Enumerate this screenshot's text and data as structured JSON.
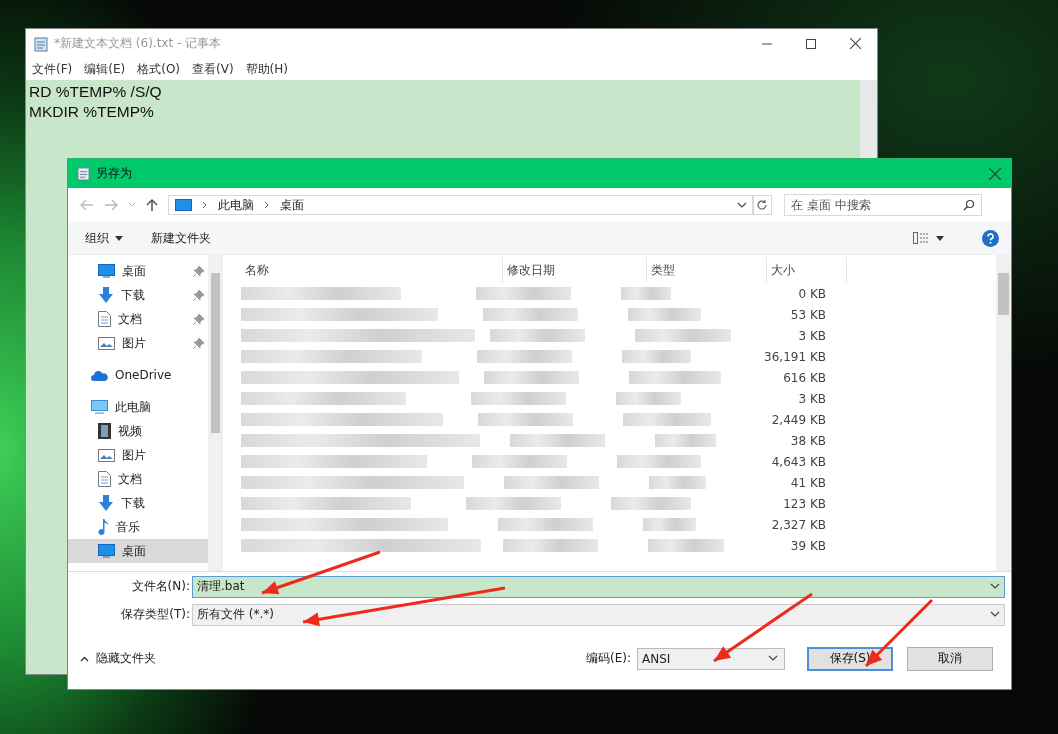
{
  "notepad": {
    "title": "*新建文本文档 (6).txt - 记事本",
    "menu": [
      "文件(F)",
      "编辑(E)",
      "格式(O)",
      "查看(V)",
      "帮助(H)"
    ],
    "lines": [
      "RD %TEMP% /S/Q",
      "MKDIR %TEMP%"
    ]
  },
  "dialog": {
    "title": "另存为",
    "breadcrumb": [
      "此电脑",
      "桌面"
    ],
    "search": {
      "placeholder": "在 桌面 中搜索"
    },
    "toolbar": {
      "organize": "组织",
      "new_folder": "新建文件夹"
    },
    "sidebar": [
      {
        "label": "桌面",
        "kind": "desktop",
        "pinned": true,
        "selected": false
      },
      {
        "label": "下载",
        "kind": "download",
        "pinned": true,
        "selected": false
      },
      {
        "label": "文档",
        "kind": "document",
        "pinned": true,
        "selected": false
      },
      {
        "label": "图片",
        "kind": "picture",
        "pinned": true,
        "selected": false
      },
      {
        "label": "OneDrive",
        "kind": "cloud",
        "pinned": false,
        "selected": false
      },
      {
        "label": "此电脑",
        "kind": "pc",
        "pinned": false,
        "selected": false
      },
      {
        "label": "视频",
        "kind": "video",
        "pinned": false,
        "selected": false
      },
      {
        "label": "图片",
        "kind": "picture",
        "pinned": false,
        "selected": false
      },
      {
        "label": "文档",
        "kind": "document",
        "pinned": false,
        "selected": false
      },
      {
        "label": "下载",
        "kind": "download",
        "pinned": false,
        "selected": false
      },
      {
        "label": "音乐",
        "kind": "music",
        "pinned": false,
        "selected": false
      },
      {
        "label": "桌面",
        "kind": "desktop",
        "pinned": false,
        "selected": true
      }
    ],
    "columns": [
      "名称",
      "修改日期",
      "类型",
      "大小"
    ],
    "rows": [
      {
        "size": "0 KB"
      },
      {
        "size": "53 KB"
      },
      {
        "size": "3 KB"
      },
      {
        "size": "36,191 KB"
      },
      {
        "size": "616 KB"
      },
      {
        "size": "3 KB"
      },
      {
        "size": "2,449 KB"
      },
      {
        "size": "38 KB"
      },
      {
        "size": "4,643 KB"
      },
      {
        "size": "41 KB"
      },
      {
        "size": "123 KB"
      },
      {
        "size": "2,327 KB"
      },
      {
        "size": "39 KB"
      }
    ],
    "filename": {
      "label": "文件名(N):",
      "value": "清理.bat"
    },
    "filetype": {
      "label": "保存类型(T):",
      "value": "所有文件 (*.*)"
    },
    "hide_folders": "隐藏文件夹",
    "encoding": {
      "label": "编码(E):",
      "value": "ANSI"
    },
    "buttons": [
      "保存(S)",
      "取消"
    ]
  }
}
